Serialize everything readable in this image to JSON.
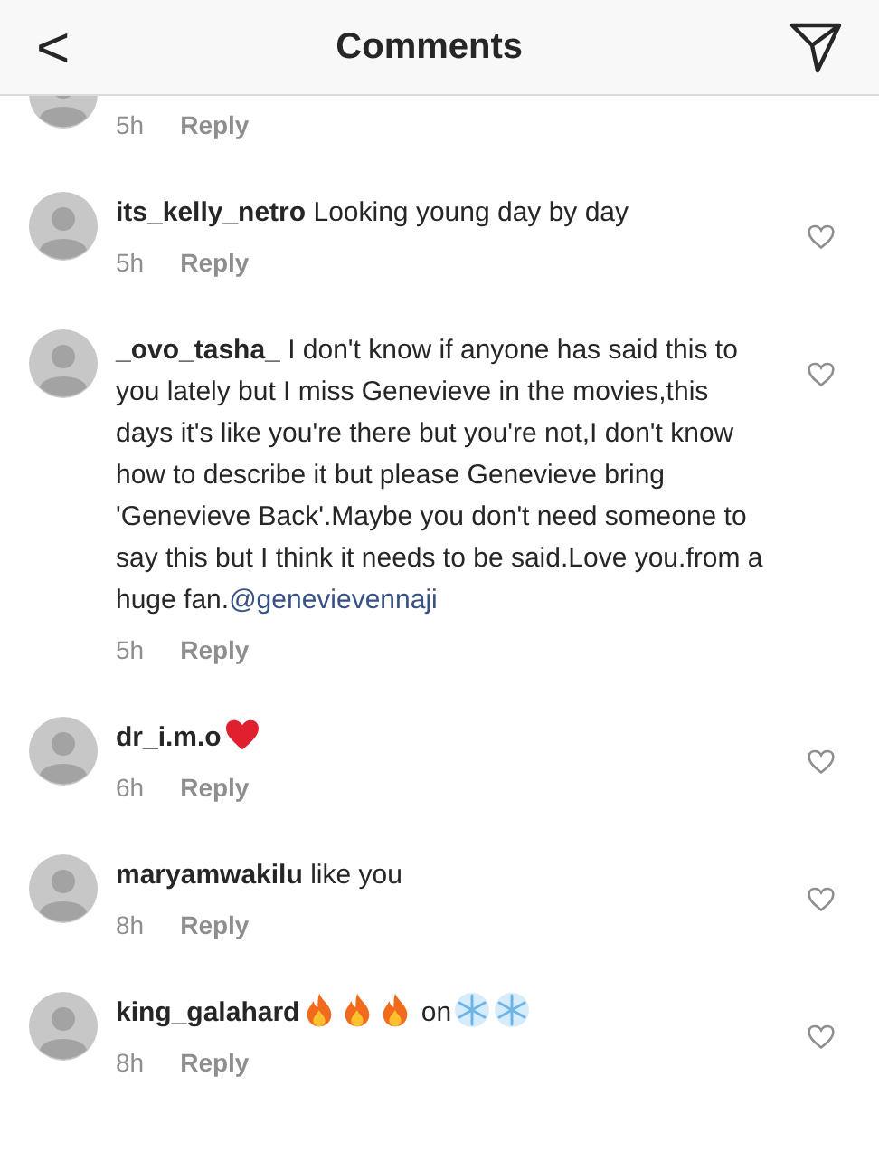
{
  "header": {
    "back": "<",
    "title": "Comments"
  },
  "comments": [
    {
      "partial": true,
      "time": "5h",
      "reply": "Reply"
    },
    {
      "username": "its_kelly_netro",
      "parts": [
        {
          "kind": "text",
          "text": "Looking young day by day"
        }
      ],
      "time": "5h",
      "reply": "Reply"
    },
    {
      "username": "_ovo_tasha_",
      "parts": [
        {
          "kind": "text",
          "text": "I don't know if anyone has said this to you lately but I miss Genevieve in the movies,this days it's like you're there but you're not,I don't know how to describe it but please Genevieve bring 'Genevieve Back'.Maybe you don't need someone to say this but I think it needs to be said.Love you.from a huge fan."
        },
        {
          "kind": "mention",
          "text": "@genevievennaji"
        }
      ],
      "time": "5h",
      "reply": "Reply"
    },
    {
      "username": "dr_i.m.o",
      "parts": [
        {
          "kind": "heart"
        }
      ],
      "time": "6h",
      "reply": "Reply"
    },
    {
      "username": "maryamwakilu",
      "parts": [
        {
          "kind": "text",
          "text": "like you"
        }
      ],
      "time": "8h",
      "reply": "Reply"
    },
    {
      "username": "king_galahard",
      "parts": [
        {
          "kind": "fire"
        },
        {
          "kind": "fire"
        },
        {
          "kind": "fire"
        },
        {
          "kind": "text",
          "text": "on"
        },
        {
          "kind": "snowflake"
        },
        {
          "kind": "snowflake"
        }
      ],
      "time": "8h",
      "reply": "Reply"
    }
  ]
}
